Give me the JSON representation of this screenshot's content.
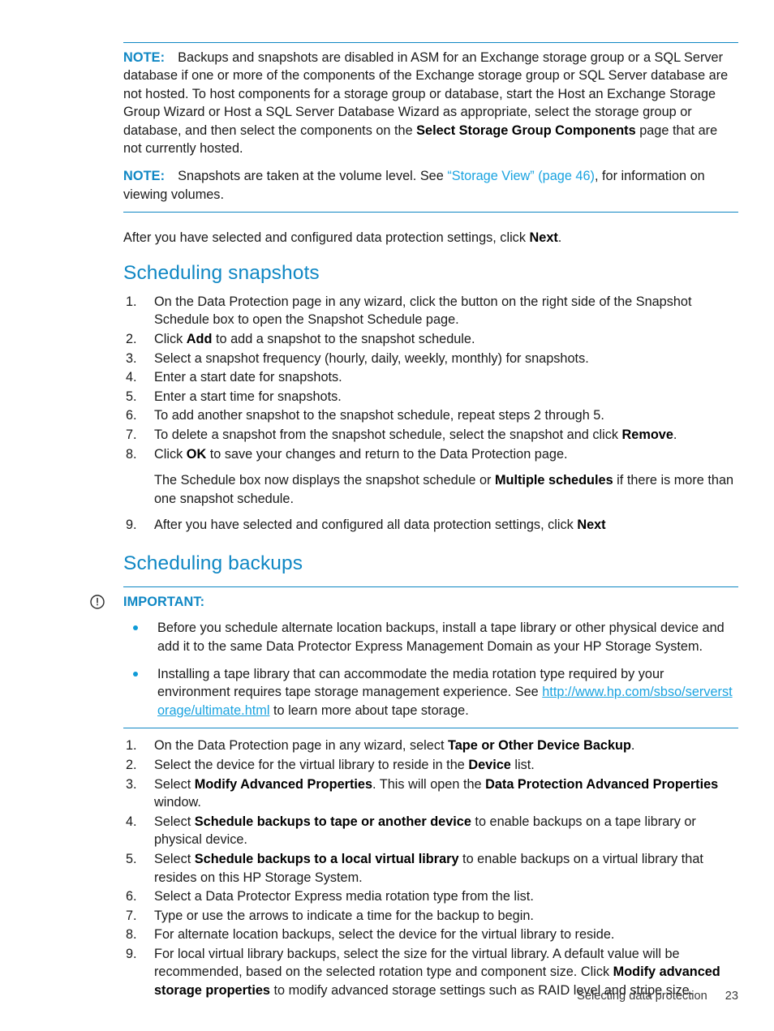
{
  "document": {
    "page_number": "23",
    "footer_title": "Selecting data protection",
    "colors": {
      "accent_blue": "#0f87c4",
      "heading_blue": "#0f87c4",
      "link_blue": "#1aa3e0",
      "bullet_blue": "#0f9bd7",
      "body_text": "#1a1a1a"
    }
  },
  "notes": {
    "label": "NOTE:",
    "note1": "Backups and snapshots are disabled in ASM for an Exchange storage group or a SQL Server database if one or more of the components of the Exchange storage group or SQL Server database are not hosted. To host components for a storage group or database, start the Host an Exchange Storage Group Wizard or Host a SQL Server Database Wizard as appropriate, select the storage group or database, and then select the components on the ",
    "note1_bold": "Select Storage Group Components",
    "note1_tail": " page that are not currently hosted.",
    "note2_lead": "Snapshots are taken at the volume level. See ",
    "note2_link": "“Storage View” (page 46)",
    "note2_tail": ", for information on viewing volumes."
  },
  "intro": {
    "text_before": "After you have selected and configured data protection settings, click ",
    "bold": "Next",
    "text_after": "."
  },
  "section_snapshots": {
    "heading": "Scheduling snapshots",
    "steps": [
      {
        "num": "1.",
        "parts": [
          {
            "t": "On the Data Protection page in any wizard, click the button on the right side of the Snapshot Schedule box to open the Snapshot Schedule page.",
            "b": false
          }
        ]
      },
      {
        "num": "2.",
        "parts": [
          {
            "t": "Click ",
            "b": false
          },
          {
            "t": "Add",
            "b": true
          },
          {
            "t": " to add a snapshot to the snapshot schedule.",
            "b": false
          }
        ]
      },
      {
        "num": "3.",
        "parts": [
          {
            "t": "Select a snapshot frequency (hourly, daily, weekly, monthly) for snapshots.",
            "b": false
          }
        ]
      },
      {
        "num": "4.",
        "parts": [
          {
            "t": "Enter a start date for snapshots.",
            "b": false
          }
        ]
      },
      {
        "num": "5.",
        "parts": [
          {
            "t": "Enter a start time for snapshots.",
            "b": false
          }
        ]
      },
      {
        "num": "6.",
        "parts": [
          {
            "t": "To add another snapshot to the snapshot schedule, repeat steps 2 through 5.",
            "b": false
          }
        ]
      },
      {
        "num": "7.",
        "parts": [
          {
            "t": "To delete a snapshot from the snapshot schedule, select the snapshot and click ",
            "b": false
          },
          {
            "t": "Remove",
            "b": true
          },
          {
            "t": ".",
            "b": false
          }
        ]
      },
      {
        "num": "8.",
        "parts": [
          {
            "t": "Click ",
            "b": false
          },
          {
            "t": "OK",
            "b": true
          },
          {
            "t": " to save your changes and return to the Data Protection page.",
            "b": false
          }
        ]
      }
    ],
    "step8_followup": {
      "parts": [
        {
          "t": "The Schedule box now displays the snapshot schedule or ",
          "b": false
        },
        {
          "t": "Multiple schedules",
          "b": true
        },
        {
          "t": " if there is more than one snapshot schedule.",
          "b": false
        }
      ]
    },
    "step9": {
      "num": "9.",
      "parts": [
        {
          "t": "After you have selected and configured all data protection settings, click ",
          "b": false
        },
        {
          "t": "Next",
          "b": true
        }
      ]
    }
  },
  "section_backups": {
    "heading": "Scheduling backups",
    "important": {
      "label": "IMPORTANT:",
      "icon": "exclamation-circle-icon",
      "bullets": [
        {
          "parts": [
            {
              "t": "Before you schedule alternate location backups, install a tape library or other physical device and add it to the same Data Protector Express Management Domain as your HP Storage System.",
              "b": false
            }
          ]
        },
        {
          "parts": [
            {
              "t": "Installing a tape library that can accommodate the media rotation type required by your environment requires tape storage management experience. See ",
              "b": false
            },
            {
              "t": "http://www.hp.com/sbso/serverstorage/ultimate.html",
              "link": true
            },
            {
              "t": " to learn more about tape storage.",
              "b": false
            }
          ]
        }
      ]
    },
    "steps": [
      {
        "num": "1.",
        "parts": [
          {
            "t": "On the Data Protection page in any wizard, select ",
            "b": false
          },
          {
            "t": "Tape or Other Device Backup",
            "b": true
          },
          {
            "t": ".",
            "b": false
          }
        ]
      },
      {
        "num": "2.",
        "parts": [
          {
            "t": "Select the device for the virtual library to reside in the ",
            "b": false
          },
          {
            "t": "Device",
            "b": true
          },
          {
            "t": " list.",
            "b": false
          }
        ]
      },
      {
        "num": "3.",
        "parts": [
          {
            "t": "Select ",
            "b": false
          },
          {
            "t": "Modify Advanced Properties",
            "b": true
          },
          {
            "t": ". This will open the ",
            "b": false
          },
          {
            "t": "Data Protection Advanced Properties",
            "b": true
          },
          {
            "t": " window.",
            "b": false
          }
        ]
      },
      {
        "num": "4.",
        "parts": [
          {
            "t": "Select ",
            "b": false
          },
          {
            "t": "Schedule backups to tape or another device",
            "b": true
          },
          {
            "t": " to enable backups on a tape library or physical device.",
            "b": false
          }
        ]
      },
      {
        "num": "5.",
        "parts": [
          {
            "t": "Select ",
            "b": false
          },
          {
            "t": "Schedule backups to a local virtual library",
            "b": true
          },
          {
            "t": " to enable backups on a virtual library that resides on this HP Storage System.",
            "b": false
          }
        ]
      },
      {
        "num": "6.",
        "parts": [
          {
            "t": "Select a Data Protector Express media rotation type from the list.",
            "b": false
          }
        ]
      },
      {
        "num": "7.",
        "parts": [
          {
            "t": "Type or use the arrows to indicate a time for the backup to begin.",
            "b": false
          }
        ]
      },
      {
        "num": "8.",
        "parts": [
          {
            "t": "For alternate location backups, select the device for the virtual library to reside.",
            "b": false
          }
        ]
      },
      {
        "num": "9.",
        "parts": [
          {
            "t": "For local virtual library backups, select the size for the virtual library. A default value will be recommended, based on the selected rotation type and component size. Click ",
            "b": false
          },
          {
            "t": "Modify advanced storage properties",
            "b": true
          },
          {
            "t": " to modify advanced storage settings such as RAID level and stripe size.",
            "b": false
          }
        ]
      }
    ]
  }
}
